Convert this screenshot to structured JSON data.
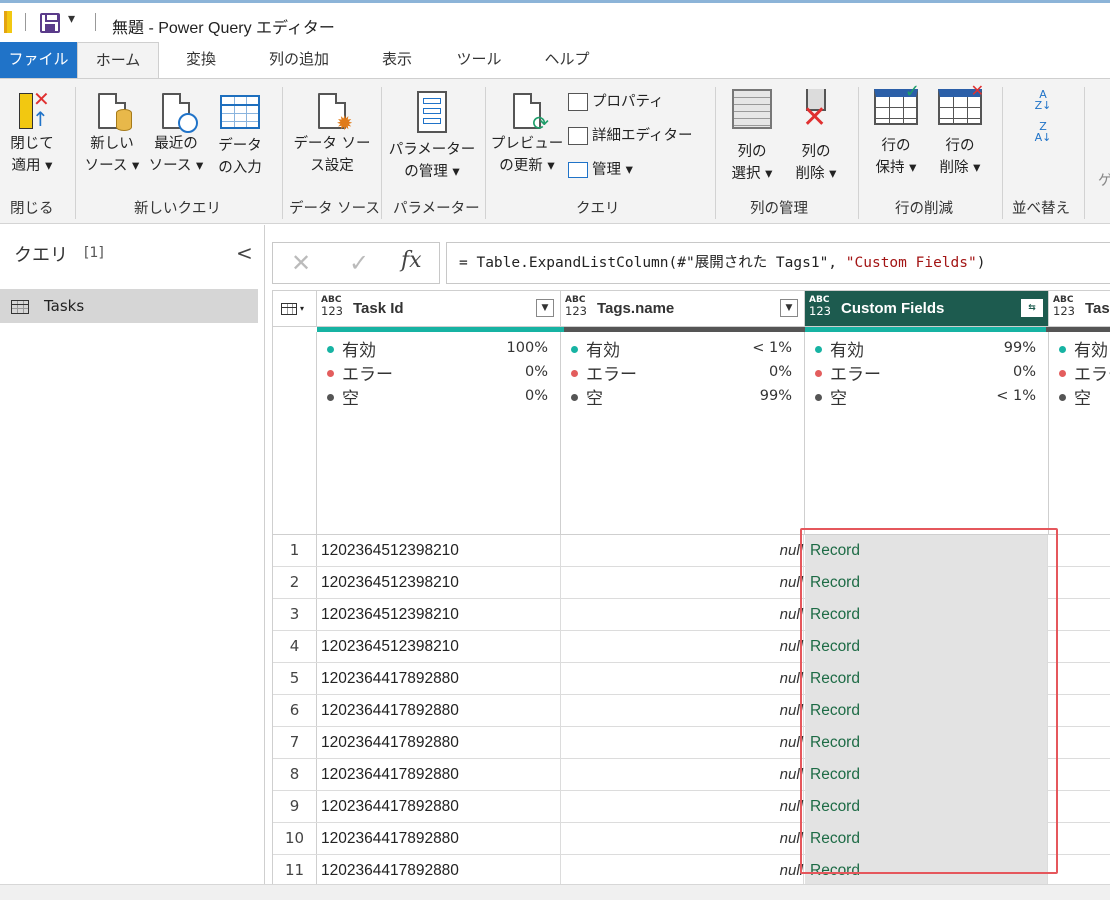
{
  "title_bar": {
    "quick_access_dropdown": "▾",
    "title": "無題 - Power Query エディター"
  },
  "tabs": [
    "ファイル",
    "ホーム",
    "変換",
    "列の追加",
    "表示",
    "ツール",
    "ヘルプ"
  ],
  "ribbon": {
    "groups": {
      "close": "閉じる",
      "new_query": "新しいクエリ",
      "data_source": "データ ソース",
      "parameters": "パラメーター",
      "query": "クエリ",
      "column_mgmt": "列の管理",
      "row_reduce": "行の削減",
      "sort": "並べ替え"
    },
    "buttons": {
      "close_apply": "閉じて\n適用 ▾",
      "new_source": "新しい\nソース ▾",
      "recent_source": "最近の\nソース ▾",
      "enter_data": "データ\nの入力",
      "data_source_settings": "データ ソー\nス設定",
      "manage_params": "パラメーター\nの管理 ▾",
      "refresh_preview": "プレビュー\nの更新 ▾",
      "properties": "プロパティ",
      "advanced_editor": "詳細エディター",
      "manage": "管理 ▾",
      "choose_columns": "列の\n選択 ▾",
      "remove_columns": "列の\n削除 ▾",
      "keep_rows": "行の\n保持 ▾",
      "remove_rows": "行の\n削除 ▾",
      "sort_asc": "A\nZ↓",
      "sort_desc": "Z\nA↓",
      "cut_off": "ゲ"
    }
  },
  "queries_pane": {
    "title": "クエリ",
    "count": "[1]",
    "collapse": "<",
    "items": [
      "Tasks"
    ]
  },
  "formula_bar": {
    "cancel": "✕",
    "confirm": "✓",
    "fx": "fx",
    "expr_prefix": "= Table.ExpandListColumn(#\"展開された Tags1\", ",
    "expr_string": "\"Custom Fields\"",
    "expr_suffix": ")"
  },
  "grid": {
    "type_badge_top": "ABC",
    "type_badge_bottom": "123",
    "columns": [
      {
        "name": "Task Id",
        "valid": "100%",
        "error": "0%",
        "empty": "0%"
      },
      {
        "name": "Tags.name",
        "valid": "< 1%",
        "error": "0%",
        "empty": "99%"
      },
      {
        "name": "Custom Fields",
        "valid": "99%",
        "error": "0%",
        "empty": "< 1%"
      },
      {
        "name": "Tas"
      }
    ],
    "profile_labels": {
      "valid": "有効",
      "error": "エラー",
      "empty": "空"
    },
    "partial_profile_labels": {
      "valid": "有効",
      "error": "エラー",
      "empty": "空"
    },
    "rows": [
      {
        "n": "1",
        "task_id": "1202364512398210",
        "tags_name": "null",
        "custom_fields": "Record"
      },
      {
        "n": "2",
        "task_id": "1202364512398210",
        "tags_name": "null",
        "custom_fields": "Record"
      },
      {
        "n": "3",
        "task_id": "1202364512398210",
        "tags_name": "null",
        "custom_fields": "Record"
      },
      {
        "n": "4",
        "task_id": "1202364512398210",
        "tags_name": "null",
        "custom_fields": "Record"
      },
      {
        "n": "5",
        "task_id": "1202364417892880",
        "tags_name": "null",
        "custom_fields": "Record"
      },
      {
        "n": "6",
        "task_id": "1202364417892880",
        "tags_name": "null",
        "custom_fields": "Record"
      },
      {
        "n": "7",
        "task_id": "1202364417892880",
        "tags_name": "null",
        "custom_fields": "Record"
      },
      {
        "n": "8",
        "task_id": "1202364417892880",
        "tags_name": "null",
        "custom_fields": "Record"
      },
      {
        "n": "9",
        "task_id": "1202364417892880",
        "tags_name": "null",
        "custom_fields": "Record"
      },
      {
        "n": "10",
        "task_id": "1202364417892880",
        "tags_name": "null",
        "custom_fields": "Record"
      },
      {
        "n": "11",
        "task_id": "1202364417892880",
        "tags_name": "null",
        "custom_fields": "Record"
      }
    ]
  },
  "colors": {
    "file_tab": "#2073c8",
    "selected_column_header": "#1d5b4f",
    "quality_valid": "#17b3a3",
    "quality_error": "#e35d5d",
    "quality_empty": "#555555",
    "record_link": "#1d6b45",
    "highlight_box": "#e5575c"
  }
}
